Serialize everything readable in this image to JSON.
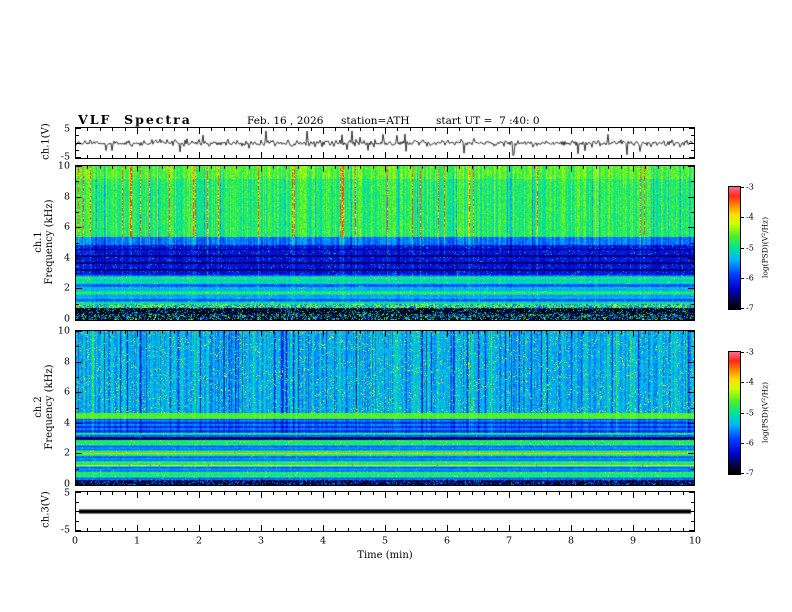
{
  "header": {
    "title": "VLF  Spectra",
    "date": "Feb. 16 , 2026",
    "station": "station=ATH",
    "start_ut": "start UT =  7 :40: 0"
  },
  "panels": {
    "ch1_wave_label": "ch.1(V)",
    "ch1_spec_label_1": "ch.1",
    "ch1_spec_label_2": "Frequency (kHz)",
    "ch2_spec_label_1": "ch.2",
    "ch2_spec_label_2": "Frequency (kHz)",
    "ch3_wave_label": "ch.3(V)"
  },
  "axes": {
    "time": {
      "label": "Time (min)",
      "ticks": [
        "0",
        "1",
        "2",
        "3",
        "4",
        "5",
        "6",
        "7",
        "8",
        "9",
        "10"
      ]
    },
    "frequency": {
      "tick_labels": [
        "10",
        "8",
        "6",
        "4",
        "2",
        "0"
      ]
    },
    "volts": {
      "top": "5",
      "bottom": "-5"
    },
    "colorbar": {
      "label": "log(PSD)(V²/Hz)",
      "ticks": [
        "-3",
        "-4",
        "-5",
        "-6",
        "-7"
      ]
    }
  },
  "chart_data": [
    {
      "type": "line",
      "panel": "ch1-waveform",
      "ylabel": "ch.1(V)",
      "ylim": [
        -5,
        5
      ],
      "xlabel": "Time (min)",
      "xlim": [
        0,
        10
      ],
      "description": "Continuous broadband noise trace centered on 0 V, typical amplitude within ±1.5 V, with frequent impulsive spikes (sferics) reaching roughly ±4 V throughout the 10-minute record."
    },
    {
      "type": "heatmap",
      "panel": "ch1-spectrogram",
      "xlabel": "Time (min)",
      "xlim": [
        0,
        10
      ],
      "ylabel": "Frequency (kHz)",
      "ylim": [
        0,
        10
      ],
      "zlabel": "log(PSD)(V²/Hz)",
      "zlim": [
        -7,
        -3
      ],
      "features": [
        "5.5-10 kHz: intense green-yellow band near -4.5 to -4 with dense vertical red transient streaks reaching about -3.3",
        "3-5.5 kHz: low-power blue region near -6.3 crossed by the same vertical transient streaks, with narrow dark horizontal lines near 3.3, 3.7, 4.2 and 4.6 kHz",
        "1-3 kHz: cyan-green horizontal banding near -5 to -4.6",
        "0.8-1 kHz: bright speckled narrow band",
        "0-0.8 kHz: mostly black (below -7) with sparse colored speckles"
      ]
    },
    {
      "type": "heatmap",
      "panel": "ch2-spectrogram",
      "xlabel": "Time (min)",
      "xlim": [
        0,
        10
      ],
      "ylabel": "Frequency (kHz)",
      "ylim": [
        0,
        10
      ],
      "zlabel": "log(PSD)(V²/Hz)",
      "zlim": [
        -7,
        -3
      ],
      "features": [
        "4.7-10 kHz: speckled cyan-green field near -5 with dense dark-blue vertical stripes near -6.5 and scattered yellow transient dots",
        "4.3-4.7 kHz: bright yellow-green horizontal band near -4.3",
        "3.4-4.3 kHz: mixed blue-green region with vertical striping",
        "0.3-3.4 kHz: layered horizontal stripes of green/cyan/yellow near -5 to -4.3 with thin orange-red lines near 0.6, 1.25 and 2.0 kHz and a dark band near 3.0 kHz",
        "0-0.3 kHz: dark with sparse speckles"
      ]
    },
    {
      "type": "line",
      "panel": "ch3-waveform",
      "ylabel": "ch.3(V)",
      "ylim": [
        -5,
        5
      ],
      "xlabel": "Time (min)",
      "xlim": [
        0,
        10
      ],
      "description": "Constant 0 V flat line drawn as a thick black horizontal bar across the whole record (channel flat / off)."
    }
  ]
}
